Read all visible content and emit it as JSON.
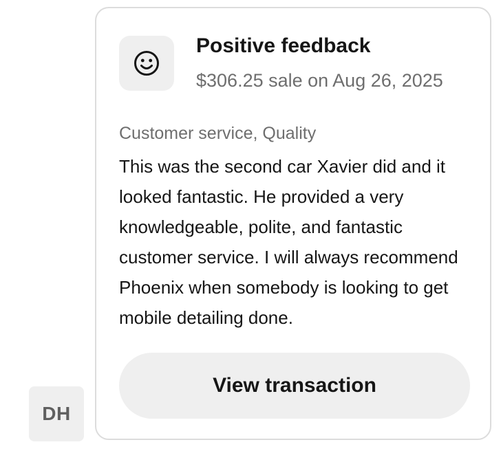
{
  "avatar": {
    "initials": "DH"
  },
  "feedback_card": {
    "icon": "smiley-face-icon",
    "title": "Positive feedback",
    "subtitle": "$306.25 sale on Aug 26, 2025",
    "tags": "Customer service, Quality",
    "body": "This was the second car Xavier did and it looked fantastic. He provided a very knowledgeable, polite, and fantastic customer service. I will always recommend Phoenix when somebody is looking to get mobile detailing done.",
    "button_label": "View transaction"
  },
  "colors": {
    "card_border": "#dcdcdc",
    "tile_background": "#efefef",
    "primary_text": "#161616",
    "secondary_text": "#6e6e6e"
  }
}
